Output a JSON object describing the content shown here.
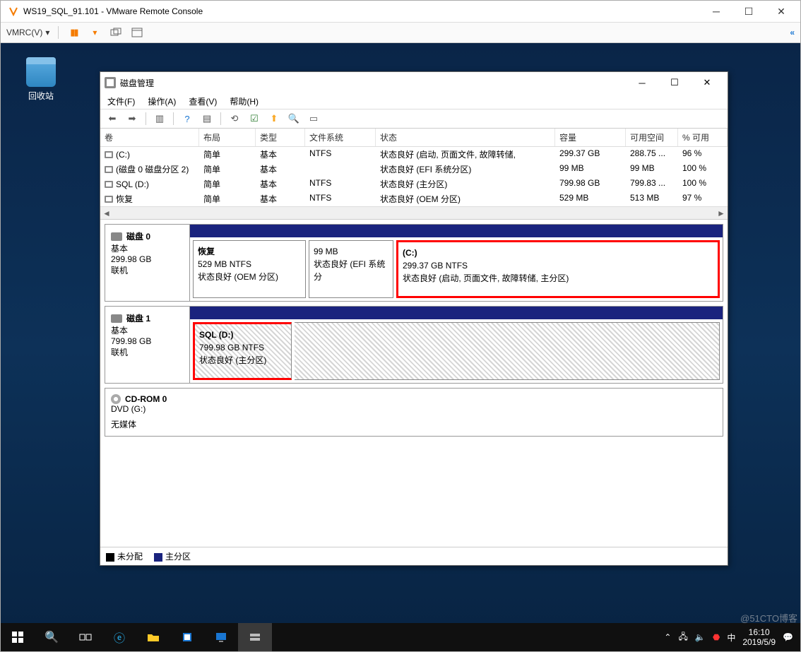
{
  "outer": {
    "title": "WS19_SQL_91.101 - VMware Remote Console",
    "menu_label": "VMRC(V)",
    "dropdown_glyph": "▾"
  },
  "desktop": {
    "recycle_bin": "回收站",
    "watermark": "@51CTO博客"
  },
  "taskbar": {
    "time": "16:10",
    "date": "2019/5/9"
  },
  "dm": {
    "title": "磁盘管理",
    "menus": {
      "file": "文件(F)",
      "action": "操作(A)",
      "view": "查看(V)",
      "help": "帮助(H)"
    },
    "columns": {
      "volume": "卷",
      "layout": "布局",
      "type": "类型",
      "fs": "文件系统",
      "status": "状态",
      "capacity": "容量",
      "free": "可用空间",
      "pct": "% 可用"
    },
    "rows": [
      {
        "vol": "(C:)",
        "layout": "简单",
        "type": "基本",
        "fs": "NTFS",
        "status": "状态良好 (启动, 页面文件, 故障转储,",
        "cap": "299.37 GB",
        "free": "288.75 ...",
        "pct": "96 %"
      },
      {
        "vol": "(磁盘 0 磁盘分区 2)",
        "layout": "简单",
        "type": "基本",
        "fs": "",
        "status": "状态良好 (EFI 系统分区)",
        "cap": "99 MB",
        "free": "99 MB",
        "pct": "100 %"
      },
      {
        "vol": "SQL (D:)",
        "layout": "简单",
        "type": "基本",
        "fs": "NTFS",
        "status": "状态良好 (主分区)",
        "cap": "799.98 GB",
        "free": "799.83 ...",
        "pct": "100 %"
      },
      {
        "vol": "恢复",
        "layout": "简单",
        "type": "基本",
        "fs": "NTFS",
        "status": "状态良好 (OEM 分区)",
        "cap": "529 MB",
        "free": "513 MB",
        "pct": "97 %"
      }
    ],
    "disks": {
      "d0": {
        "label": "磁盘 0",
        "type": "基本",
        "size": "299.98 GB",
        "status": "联机",
        "p0": {
          "title": "恢复",
          "line1": "529 MB NTFS",
          "line2": "状态良好 (OEM 分区)"
        },
        "p1": {
          "title": "",
          "line1": "99 MB",
          "line2": "状态良好 (EFI 系统分"
        },
        "p2": {
          "title": "(C:)",
          "line1": "299.37 GB NTFS",
          "line2": "状态良好 (启动, 页面文件, 故障转储, 主分区)"
        }
      },
      "d1": {
        "label": "磁盘 1",
        "type": "基本",
        "size": "799.98 GB",
        "status": "联机",
        "p0": {
          "title": "SQL  (D:)",
          "line1": "799.98 GB NTFS",
          "line2": "状态良好 (主分区)"
        }
      },
      "cd": {
        "label": "CD-ROM 0",
        "type": "DVD (G:)",
        "status": "无媒体"
      }
    },
    "legend": {
      "unalloc": "未分配",
      "primary": "主分区"
    }
  }
}
